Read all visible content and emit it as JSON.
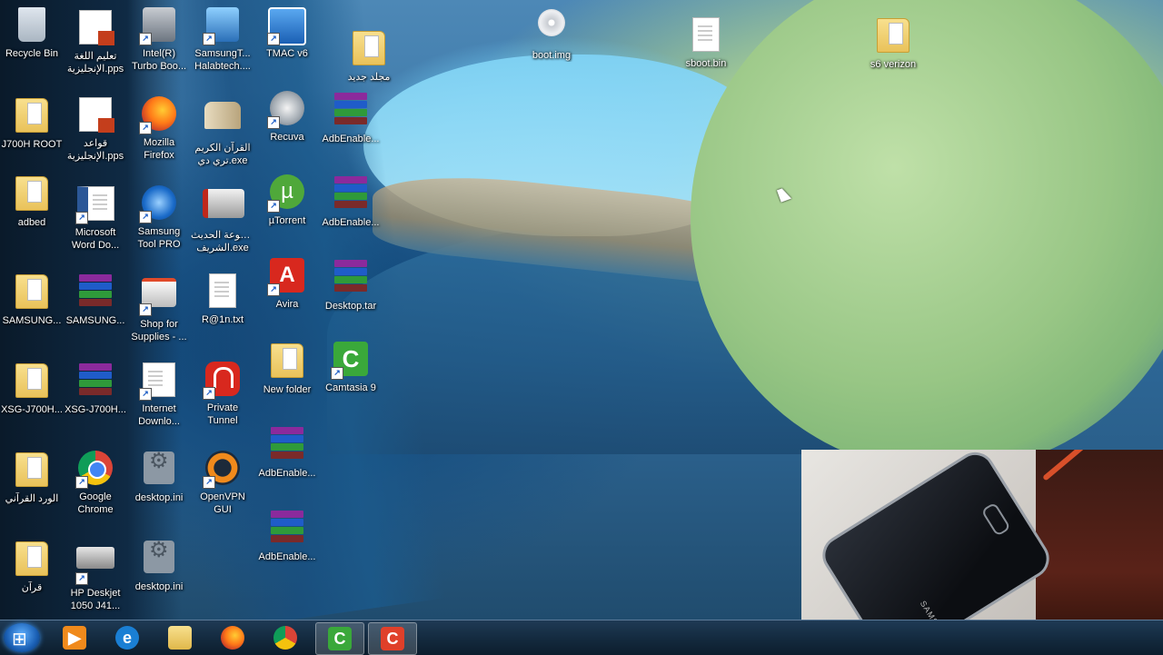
{
  "desktop": {
    "icons": [
      {
        "label": "Recycle Bin",
        "label2": ""
      },
      {
        "label": "تعليم اللغة",
        "label2": "الإنجليزية.pps"
      },
      {
        "label": "Intel(R)",
        "label2": "Turbo Boo..."
      },
      {
        "label": "SamsungT...",
        "label2": "Halabtech...."
      },
      {
        "label": "TMAC v6",
        "label2": ""
      },
      {
        "label": "مجلد جديد",
        "label2": ""
      },
      {
        "label": "boot.img",
        "label2": ""
      },
      {
        "label": "sboot.bin",
        "label2": ""
      },
      {
        "label": "s6 verizon",
        "label2": ""
      },
      {
        "label": "J700H ROOT",
        "label2": ""
      },
      {
        "label": "قواعد",
        "label2": "الإنجليزية.pps"
      },
      {
        "label": "Mozilla",
        "label2": "Firefox"
      },
      {
        "label": "القرآن الكريم",
        "label2": "تري دي.exe"
      },
      {
        "label": "Recuva",
        "label2": ""
      },
      {
        "label": "AdbEnable...",
        "label2": ""
      },
      {
        "label": "adbed",
        "label2": ""
      },
      {
        "label": "Microsoft",
        "label2": "Word Do..."
      },
      {
        "label": "Samsung",
        "label2": "Tool PRO"
      },
      {
        "label": "موسوعة الحديث",
        "label2": "الشريف.exe"
      },
      {
        "label": "µTorrent",
        "label2": ""
      },
      {
        "label": "AdbEnable...",
        "label2": ""
      },
      {
        "label": "SAMSUNG...",
        "label2": ""
      },
      {
        "label": "SAMSUNG...",
        "label2": ""
      },
      {
        "label": "Shop for",
        "label2": "Supplies - ..."
      },
      {
        "label": "R@1n.txt",
        "label2": ""
      },
      {
        "label": "Avira",
        "label2": ""
      },
      {
        "label": "Desktop.tar",
        "label2": ""
      },
      {
        "label": "XSG-J700H...",
        "label2": ""
      },
      {
        "label": "XSG-J700H...",
        "label2": ""
      },
      {
        "label": "Internet",
        "label2": "Downlo..."
      },
      {
        "label": "Private",
        "label2": "Tunnel"
      },
      {
        "label": "New folder",
        "label2": ""
      },
      {
        "label": "Camtasia 9",
        "label2": ""
      },
      {
        "label": "AdbEnable...",
        "label2": ""
      },
      {
        "label": "الورد القرآني",
        "label2": ""
      },
      {
        "label": "Google",
        "label2": "Chrome"
      },
      {
        "label": "desktop.ini",
        "label2": ""
      },
      {
        "label": "OpenVPN",
        "label2": "GUI"
      },
      {
        "label": "AdbEnable...",
        "label2": ""
      },
      {
        "label": "قرآن",
        "label2": ""
      },
      {
        "label": "HP Deskjet",
        "label2": "1050 J41..."
      },
      {
        "label": "desktop.ini",
        "label2": ""
      }
    ]
  },
  "taskbar": {
    "start_label": "Start",
    "buttons": [
      "media-player",
      "internet-explorer",
      "file-explorer",
      "firefox",
      "chrome",
      "camtasia-recorder",
      "camtasia-studio"
    ]
  },
  "webcam": {
    "brand_text": "SAMSUNG"
  }
}
